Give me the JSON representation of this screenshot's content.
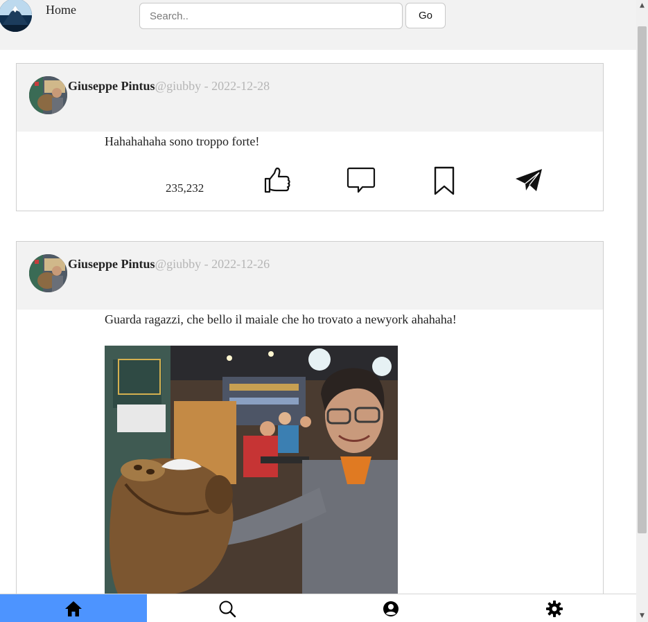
{
  "header": {
    "home_label": "Home",
    "search_placeholder": "Search..",
    "go_label": "Go"
  },
  "posts": [
    {
      "author_name": "Giuseppe Pintus",
      "author_meta": "@giubby - 2022-12-28",
      "text": "Hahahahaha sono troppo forte!",
      "like_count": "235,232",
      "has_image": false
    },
    {
      "author_name": "Giuseppe Pintus",
      "author_meta": "@giubby - 2022-12-26",
      "text": "Guarda ragazzi, che bello il maiale che ho trovato a newyork ahahaha!",
      "has_image": true
    }
  ],
  "bottom_nav": {
    "items": [
      "home-icon",
      "search-icon",
      "user-icon",
      "gear-icon"
    ],
    "active": "home",
    "active_color": "#4d94ff"
  }
}
